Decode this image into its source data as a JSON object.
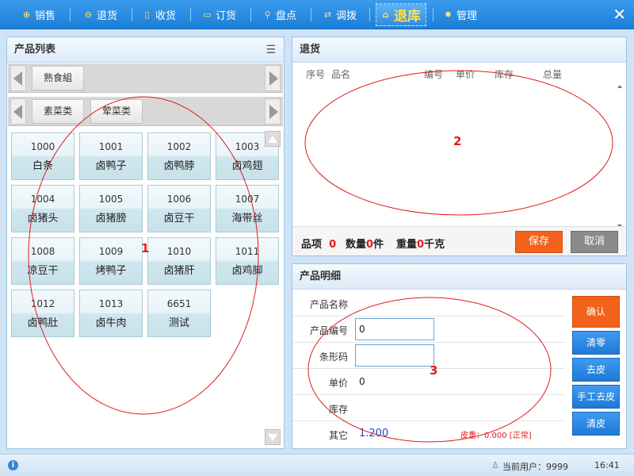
{
  "nav": {
    "tabs": [
      {
        "label": "销售",
        "icon": "plus-circle-icon"
      },
      {
        "label": "退货",
        "icon": "minus-circle-icon"
      },
      {
        "label": "收货",
        "icon": "document-icon"
      },
      {
        "label": "订货",
        "icon": "chat-icon"
      },
      {
        "label": "盘点",
        "icon": "search-icon"
      },
      {
        "label": "调拨",
        "icon": "transfer-icon"
      },
      {
        "label": "退库",
        "icon": "home-icon",
        "active": true
      },
      {
        "label": "管理",
        "icon": "gear-icon"
      }
    ],
    "close": "✕"
  },
  "product_list": {
    "title": "产品列表",
    "menu_icon": "list-icon",
    "category_row1": [
      "熟食組"
    ],
    "category_row2": [
      "素菜类",
      "荤菜类"
    ],
    "products": [
      {
        "code": "1000",
        "name": "白条"
      },
      {
        "code": "1001",
        "name": "卤鸭子"
      },
      {
        "code": "1002",
        "name": "卤鸭脖"
      },
      {
        "code": "1003",
        "name": "卤鸡翅"
      },
      {
        "code": "1004",
        "name": "卤猪头"
      },
      {
        "code": "1005",
        "name": "卤猪膀"
      },
      {
        "code": "1006",
        "name": "卤豆干"
      },
      {
        "code": "1007",
        "name": "海带丝"
      },
      {
        "code": "1008",
        "name": "凉豆干"
      },
      {
        "code": "1009",
        "name": "烤鸭子"
      },
      {
        "code": "1010",
        "name": "卤猪肝"
      },
      {
        "code": "1011",
        "name": "卤鸡脚"
      },
      {
        "code": "1012",
        "name": "卤鸭肚"
      },
      {
        "code": "1013",
        "name": "卤牛肉"
      },
      {
        "code": "6651",
        "name": "测试"
      }
    ]
  },
  "returns": {
    "title": "退货",
    "columns": [
      "序号",
      "品名",
      "编号",
      "单价",
      "库存",
      "总量"
    ],
    "summary": {
      "items_label": "品项",
      "items_value": "0",
      "qty_label": "数量",
      "qty_value": "0",
      "qty_unit": "件",
      "weight_label": "重量",
      "weight_value": "0",
      "weight_unit": "千克"
    },
    "save_label": "保存",
    "cancel_label": "取消"
  },
  "detail": {
    "title": "产品明细",
    "name_label": "产品名称",
    "code_label": "产品编号",
    "code_value": "0",
    "barcode_label": "条形码",
    "barcode_value": "",
    "price_label": "单价",
    "price_value": "0",
    "stock_label": "库存",
    "other_label": "其它",
    "other_value": "1.200",
    "tare_text": "皮重：0.000 [正常]",
    "buttons": [
      "确认",
      "清零",
      "去皮",
      "手工去皮",
      "清皮"
    ]
  },
  "annotations": [
    "1",
    "2",
    "3"
  ],
  "status": {
    "user_label": "当前用户：9999",
    "time": "16:41"
  },
  "colors": {
    "accent_blue": "#1f7fd8",
    "confirm_orange": "#f2621a",
    "annotation_red": "#e21b1b",
    "tab_highlight": "#ffe14a"
  }
}
